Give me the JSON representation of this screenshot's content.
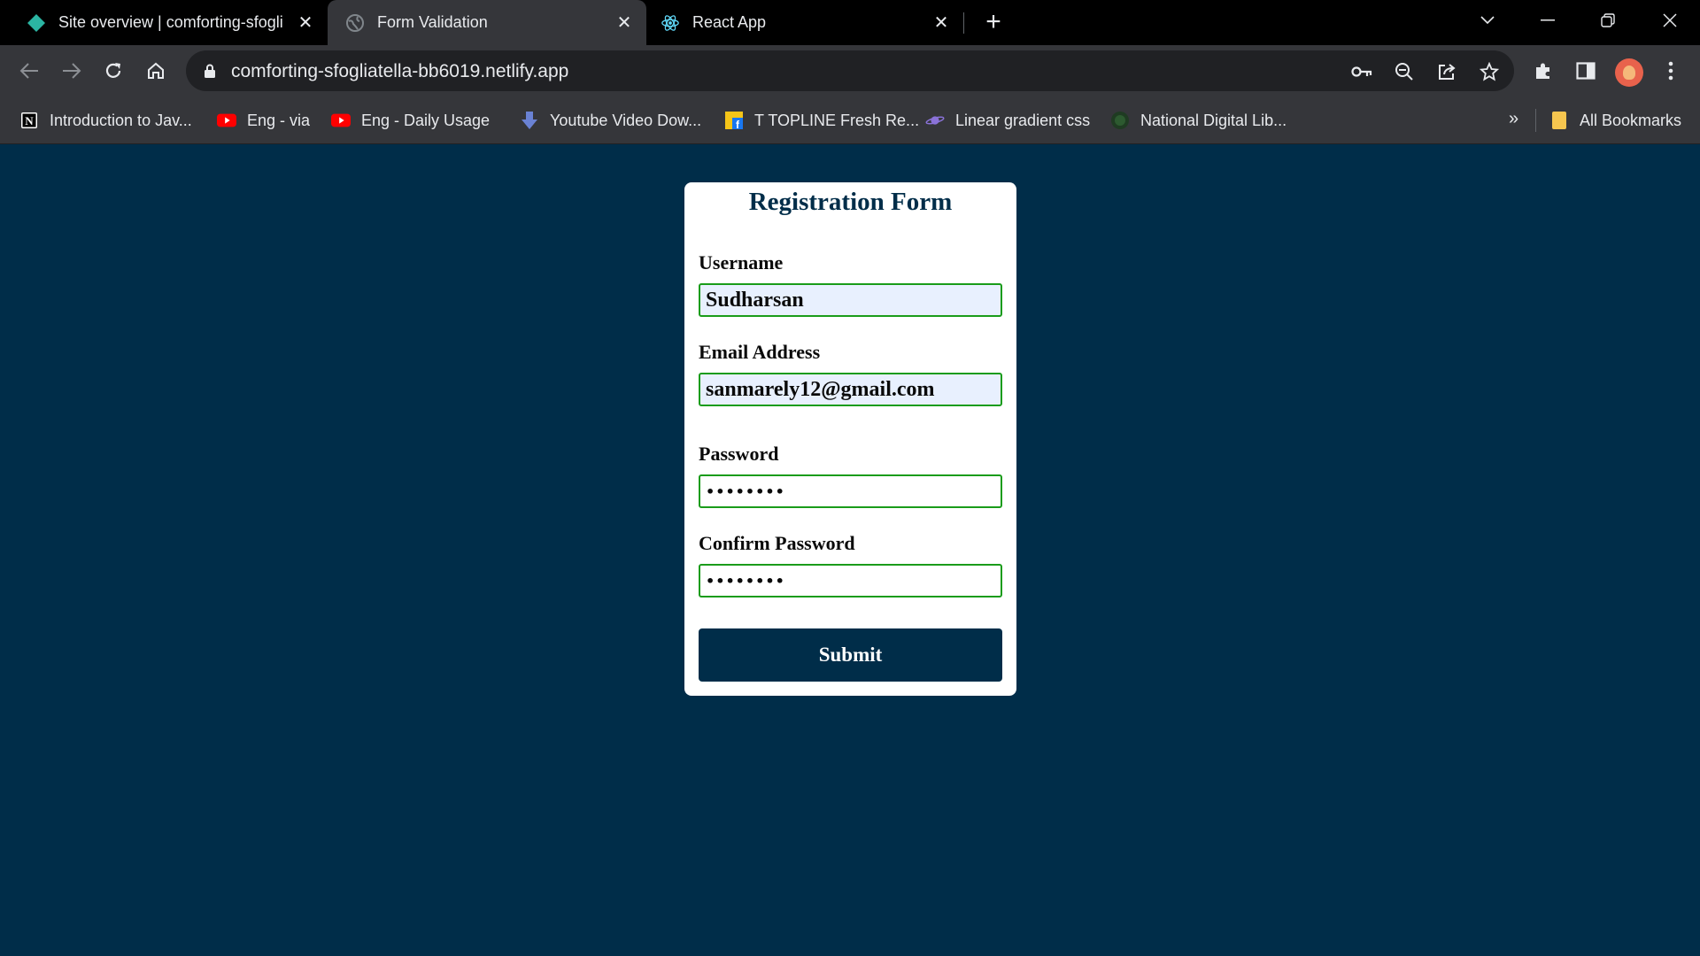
{
  "tabs": [
    {
      "title": "Site overview | comforting-sfogli",
      "icon": "netlify-diamond-icon",
      "active": false
    },
    {
      "title": "Form Validation",
      "icon": "globe-icon",
      "active": true
    },
    {
      "title": "React App",
      "icon": "react-atom-icon",
      "active": false
    }
  ],
  "address_bar": {
    "url": "comforting-sfogliatella-bb6019.netlify.app"
  },
  "bookmarks": [
    {
      "label": "Introduction to Jav...",
      "icon": "notion-icon"
    },
    {
      "label": "Eng - via",
      "icon": "youtube-icon"
    },
    {
      "label": "Eng -  Daily Usage",
      "icon": "youtube-icon"
    },
    {
      "label": "Youtube Video Dow...",
      "icon": "download-arrow-icon"
    },
    {
      "label": "T TOPLINE Fresh Re...",
      "icon": "facebook-like-icon"
    },
    {
      "label": "Linear gradient css",
      "icon": "saturn-icon"
    },
    {
      "label": "National Digital Lib...",
      "icon": "ndl-logo-icon"
    }
  ],
  "bookmarks_overflow": "»",
  "all_bookmarks": "All Bookmarks",
  "form": {
    "title": "Registration Form",
    "username_label": "Username",
    "username_value": "Sudharsan",
    "email_label": "Email Address",
    "email_value": "sanmarely12@gmail.com",
    "password_label": "Password",
    "password_value": "••••••••",
    "confirm_label": "Confirm Password",
    "confirm_value": "••••••••",
    "submit_label": "Submit"
  },
  "colors": {
    "page_background": "#002d49",
    "card_background": "#ffffff",
    "input_border_valid": "#1a9c1a",
    "autofill_background": "#e8f0fe",
    "button_background": "#002d49"
  }
}
